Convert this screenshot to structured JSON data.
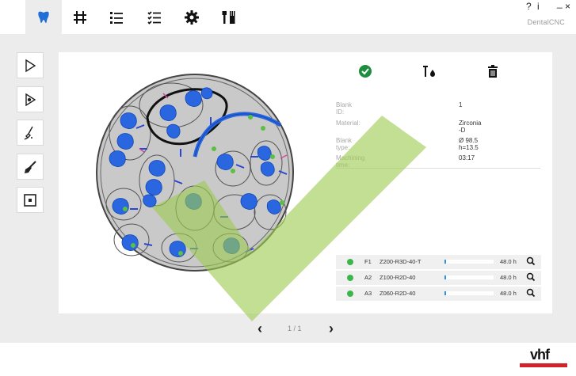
{
  "top_tabs": [
    {
      "icon": "tooth-icon",
      "active": true
    },
    {
      "icon": "crosshair-icon",
      "active": false
    },
    {
      "icon": "list-icon",
      "active": false
    },
    {
      "icon": "checklist-icon",
      "active": false
    },
    {
      "icon": "gear-icon",
      "active": false
    },
    {
      "icon": "tools-icon",
      "active": false
    }
  ],
  "window": {
    "help": "?",
    "info": "i",
    "minimize": "_",
    "close": "×",
    "brand": "DentalCNC"
  },
  "left_tools": [
    "play-icon",
    "eye-play-icon",
    "milling-tool-icon",
    "brush-icon",
    "target-square-icon"
  ],
  "actions": [
    "confirm-check-icon",
    "tool-drop-icon",
    "trash-icon"
  ],
  "blank_info": [
    {
      "label": "Blank ID:",
      "value": "1"
    },
    {
      "label": "Material:",
      "value": "Zirconia -D"
    },
    {
      "label": "Blank type:",
      "value": "Ø 98.5  h=13.5"
    },
    {
      "label": "Machining time:",
      "value": "03:17"
    }
  ],
  "jobs": [
    {
      "pos": "F1",
      "name": "Z200-R3D-40-T",
      "progress": 0.03,
      "time": "48.0 h",
      "status": "green"
    },
    {
      "pos": "A2",
      "name": "Z100-R2D-40",
      "progress": 0.03,
      "time": "48.0 h",
      "status": "green"
    },
    {
      "pos": "A3",
      "name": "Z060-R2D-40",
      "progress": 0.03,
      "time": "48.0 h",
      "status": "green"
    }
  ],
  "pager": {
    "prev": "‹",
    "text": "1 / 1",
    "next": "›"
  },
  "logo": "vhf",
  "colors": {
    "accent": "#2f6fe0",
    "check": "#1e8e3e",
    "watermark": "#9ccc50",
    "logo_red": "#d2232a"
  }
}
